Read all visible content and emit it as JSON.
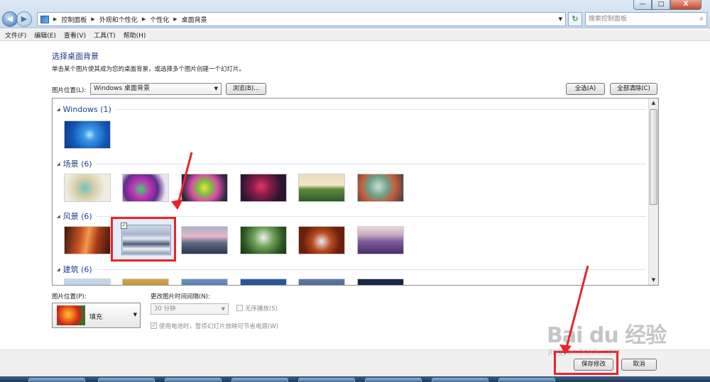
{
  "address_bar": {
    "crumbs": [
      "控制面板",
      "外观和个性化",
      "个性化",
      "桌面背景"
    ],
    "search_placeholder": "搜索控制面板"
  },
  "window_controls": {
    "minimize": "—",
    "maximize": "□",
    "close": "X"
  },
  "menu": [
    "文件(F)",
    "编辑(E)",
    "查看(V)",
    "工具(T)",
    "帮助(H)"
  ],
  "content": {
    "heading": "选择桌面背景",
    "description": "单击某个图片使其成为您的桌面背景，或选择多个图片创建一个幻灯片。",
    "location_label": "图片位置(L):",
    "location_value": "Windows 桌面背景",
    "browse_label": "浏览(B)...",
    "select_all_label": "全选(A)",
    "clear_all_label": "全部清除(C)"
  },
  "gallery": {
    "groups": [
      {
        "title": "Windows (1)"
      },
      {
        "title": "场景 (6)"
      },
      {
        "title": "风景 (6)"
      },
      {
        "title": "建筑 (6)"
      }
    ],
    "selected_group": "风景 (6)",
    "selected_index": 1
  },
  "options": {
    "position_label": "图片位置(P):",
    "position_value": "填充",
    "interval_label": "更改图片时间间隔(N):",
    "interval_value": "30 分钟",
    "shuffle_label": "无序播放(S)",
    "battery_label": "使用电池时，暂停幻灯片放映可节省电源(W)"
  },
  "footer": {
    "save_label": "保存修改",
    "cancel_label": "取消"
  },
  "watermark": {
    "main": "Bai du 经验",
    "sub": "jingyan.baidu.com"
  },
  "colors": {
    "annotation": "#e8242b",
    "heading": "#1e3a8a",
    "group_title": "#1e3f8e"
  }
}
